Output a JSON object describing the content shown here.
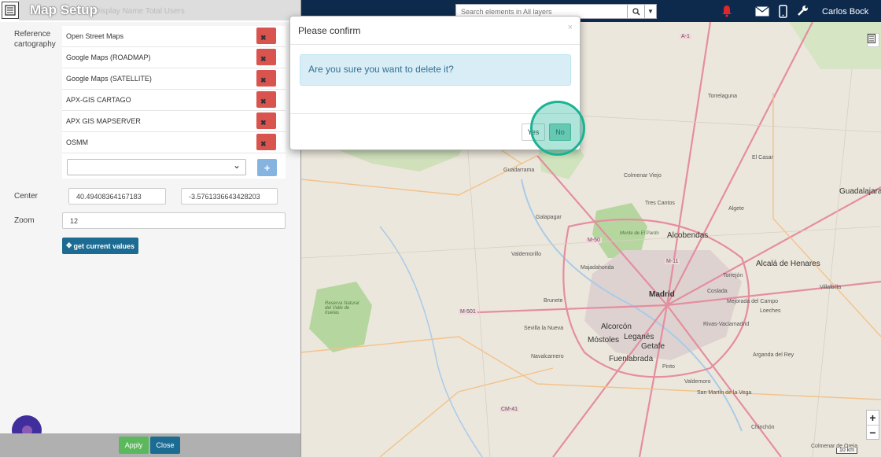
{
  "topbar": {
    "search_placeholder": "Search elements in All layers",
    "username": "Carlos Bock",
    "icons": [
      "bell-icon",
      "envelope-icon",
      "mobile-icon",
      "wrench-icon"
    ]
  },
  "panel": {
    "title": "Map Setup",
    "faded_header": "Display Name    Total Users",
    "reference_label": "Reference cartography",
    "cartographies": [
      "Open Street Maps",
      "Google Maps (ROADMAP)",
      "Google Maps (SATELLITE)",
      "APX-GIS CARTAGO",
      "APX GIS MAPSERVER",
      "OSMM"
    ],
    "carto_select_value": "",
    "center_label": "Center",
    "center_lat": "40.49408364167183",
    "center_lon": "-3.5761336643428203",
    "zoom_label": "Zoom",
    "zoom_value": "12",
    "get_values_label": "get current values",
    "apply_label": "Apply",
    "close_label": "Close"
  },
  "modal": {
    "title": "Please confirm",
    "close_glyph": "×",
    "message": "Are you sure you want to delete it?",
    "yes_label": "Yes",
    "no_label": "No"
  },
  "map": {
    "labels": {
      "madrid": "Madrid",
      "alcobendas": "Alcobendas",
      "alcala": "Alcalá de Henares",
      "getafe": "Getafe",
      "leganes": "Leganés",
      "mostoles": "Móstoles",
      "alcorcon": "Alcorcón",
      "fuenlabrada": "Fuenlabrada",
      "guadalajara": "Guadalajara",
      "majadahonda": "Majadahonda",
      "torrelaguna": "Torrelaguna",
      "guadarrama": "Guadarrama",
      "tres_cantos": "Tres Cantos",
      "coslada": "Coslada",
      "rivas": "Rivas-Vaciamadrid",
      "arganda": "Arganda del Rey",
      "pinto": "Pinto",
      "valdemoro": "Valdemoro",
      "navalcarnero": "Navalcarnero",
      "chinchon": "Chinchón",
      "aranjuez": "Colmenar de Oreja",
      "colmenar_viejo": "Colmenar Viejo",
      "galapagar": "Galapagar",
      "sevilla_nueva": "Sevilla la Nueva",
      "brunete": "Brunete",
      "torrejon": "Torrejón",
      "el_casar": "El Casar",
      "loeches": "Loeches",
      "mejorada": "Mejorada del Campo",
      "valdemorillo": "Valdemorillo",
      "villalbilla": "Villalbilla",
      "algete": "Algete",
      "sacedon": "San Martín de la Vega",
      "park": "Monte de El Pardo",
      "park2": "Reserva Natural del Valle de Iruelas",
      "m50": "M-50",
      "m501": "M-501",
      "m11": "M-11",
      "a1": "A-1",
      "cm41": "CM-41"
    },
    "zoom_in": "+",
    "zoom_out": "−",
    "scale": "10 km"
  },
  "colors": {
    "topbar": "#0d2a4c",
    "danger": "#d9534f",
    "primary": "#1b6b92",
    "success": "#5cb85c",
    "info_bg": "#d9edf7"
  }
}
